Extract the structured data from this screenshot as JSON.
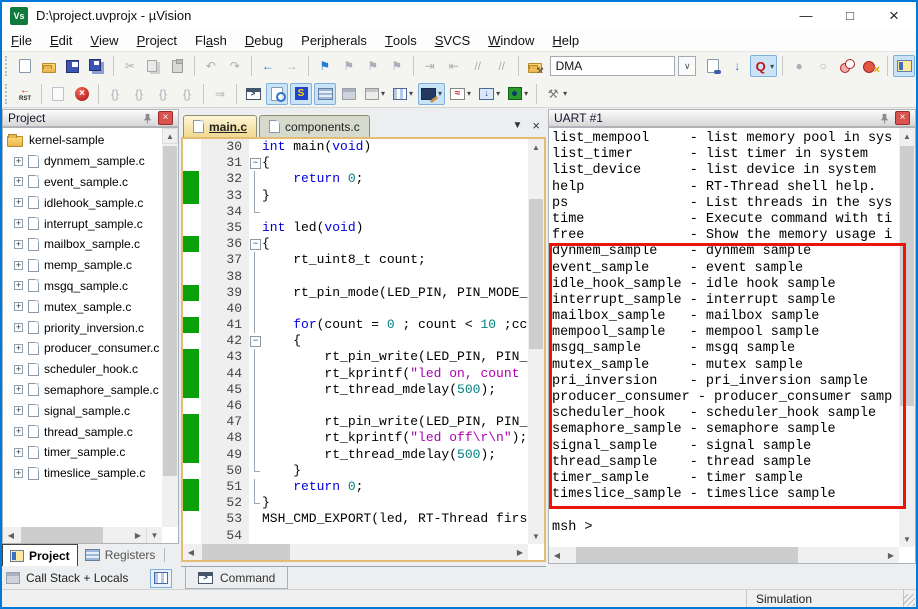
{
  "window": {
    "title": "D:\\project.uvprojx - µVision"
  },
  "colors": {
    "accent": "#0078d7",
    "annotation": "#ea1508",
    "coverage": "#0aa00a",
    "keyword": "#0000e0",
    "number": "#008080",
    "string": "#b000b0"
  },
  "menu": [
    {
      "label": "File",
      "u": 0
    },
    {
      "label": "Edit",
      "u": 0
    },
    {
      "label": "View",
      "u": 0
    },
    {
      "label": "Project",
      "u": 0
    },
    {
      "label": "Flash",
      "u": 2
    },
    {
      "label": "Debug",
      "u": 0
    },
    {
      "label": "Peripherals",
      "u": 3
    },
    {
      "label": "Tools",
      "u": 0
    },
    {
      "label": "SVCS",
      "u": 0
    },
    {
      "label": "Window",
      "u": 0
    },
    {
      "label": "Help",
      "u": 0
    }
  ],
  "toolbar1": [
    {
      "t": "grip"
    },
    {
      "n": "new-file",
      "cl": "i-doc"
    },
    {
      "n": "open-file",
      "cl": "i-folder"
    },
    {
      "n": "save-file",
      "cl": "i-floppy"
    },
    {
      "n": "save-all",
      "cl": "i-floppy2"
    },
    {
      "t": "sep"
    },
    {
      "n": "cut",
      "g": "✂",
      "cl": "g-dis"
    },
    {
      "n": "copy",
      "cl": "i-pages"
    },
    {
      "n": "paste",
      "cl": "i-clip"
    },
    {
      "t": "sep"
    },
    {
      "n": "undo",
      "g": "↶",
      "cl": "g-dis"
    },
    {
      "n": "redo",
      "g": "↷",
      "cl": "g-dis"
    },
    {
      "t": "sep"
    },
    {
      "n": "navigate-back",
      "g": "←",
      "cl": "g-blue"
    },
    {
      "n": "navigate-forward",
      "g": "→",
      "cl": "g-dis"
    },
    {
      "t": "sep"
    },
    {
      "n": "toggle-bookmark",
      "g": "⚑",
      "cl": "g-flag"
    },
    {
      "n": "prev-bookmark",
      "g": "⚑",
      "cl": "g-dis"
    },
    {
      "n": "next-bookmark",
      "g": "⚑",
      "cl": "g-dis"
    },
    {
      "n": "clear-bookmarks",
      "g": "⚑",
      "cl": "g-dis"
    },
    {
      "t": "sep"
    },
    {
      "n": "indent",
      "g": "⇥",
      "cl": "g-dis"
    },
    {
      "n": "outdent",
      "g": "⇤",
      "cl": "g-dis"
    },
    {
      "n": "comment",
      "g": "//",
      "cl": "g-dis"
    },
    {
      "n": "uncomment",
      "g": "//",
      "cl": "g-dis"
    },
    {
      "t": "sep"
    },
    {
      "n": "options-for-target",
      "cl": "i-folder i-fopt"
    },
    {
      "t": "combo",
      "n": "select-target",
      "v": "DMA"
    },
    {
      "t": "ddbtn",
      "n": "select-target-dropdown",
      "g": "∨"
    },
    {
      "n": "find-in-files",
      "cl": "i-doc i-find"
    },
    {
      "n": "find",
      "g": "↓",
      "cl": "g-blue"
    },
    {
      "n": "quick-search",
      "g": "Q",
      "cl": "g-redq",
      "hl": true,
      "dd": true
    },
    {
      "t": "sep"
    },
    {
      "n": "insert-remove-breakpoint",
      "g": "●",
      "cl": "g-dis"
    },
    {
      "n": "enable-disable-breakpoint",
      "g": "○",
      "cl": "g-dis"
    },
    {
      "n": "disable-all-breakpoints",
      "cl": "i-bp2"
    },
    {
      "n": "kill-all-breakpoints",
      "cl": "i-bpx"
    },
    {
      "t": "sep"
    },
    {
      "n": "project-window-toggle",
      "cl": "i-projwin",
      "hl": true
    }
  ],
  "toolbar2": [
    {
      "t": "grip"
    },
    {
      "n": "reset-cpu",
      "g": "RST",
      "cl": "i-rst"
    },
    {
      "t": "sep"
    },
    {
      "n": "show-next-statement",
      "cl": "i-doc i-dis"
    },
    {
      "n": "stop-debug",
      "g": "×",
      "cl": "i-stop"
    },
    {
      "t": "sep"
    },
    {
      "n": "step",
      "g": "{}",
      "cl": "g-dis"
    },
    {
      "n": "step-over",
      "g": "{}",
      "cl": "g-dis"
    },
    {
      "n": "step-out",
      "g": "{}",
      "cl": "g-dis"
    },
    {
      "n": "run-to-cursor",
      "g": "{}",
      "cl": "g-dis"
    },
    {
      "t": "sep"
    },
    {
      "n": "show-current-statement",
      "g": "⇒",
      "cl": "g-dis"
    },
    {
      "t": "sep"
    },
    {
      "n": "command-window",
      "g": ">",
      "cl": "i-term"
    },
    {
      "n": "disassembly-window",
      "cl": "i-doc i-disasm",
      "hl": true
    },
    {
      "n": "symbols-window",
      "g": "S",
      "cl": "i-sym",
      "hl": true
    },
    {
      "n": "registers-window",
      "cl": "i-reg",
      "hl": true
    },
    {
      "n": "callstack-window",
      "cl": "i-stack"
    },
    {
      "n": "watch-window",
      "cl": "i-watch",
      "dd": true
    },
    {
      "n": "memory-window",
      "cl": "i-mem",
      "dd": true
    },
    {
      "n": "serial-window",
      "cl": "i-serial",
      "hl": true,
      "dd": true
    },
    {
      "n": "analysis-window",
      "g": "≈",
      "cl": "i-analysis",
      "dd": true
    },
    {
      "n": "trace-window",
      "g": "↓",
      "cl": "i-trace",
      "dd": true
    },
    {
      "n": "system-viewer",
      "cl": "i-sysview",
      "dd": true
    },
    {
      "t": "sep"
    },
    {
      "n": "debug-tools",
      "g": "⚒",
      "cl": "g-tools",
      "dd": true
    }
  ],
  "project": {
    "title": "Project",
    "root": "kernel-sample",
    "files": [
      "dynmem_sample.c",
      "event_sample.c",
      "idlehook_sample.c",
      "interrupt_sample.c",
      "mailbox_sample.c",
      "memp_sample.c",
      "msgq_sample.c",
      "mutex_sample.c",
      "priority_inversion.c",
      "producer_consumer.c",
      "scheduler_hook.c",
      "semaphore_sample.c",
      "signal_sample.c",
      "thread_sample.c",
      "timer_sample.c",
      "timeslice_sample.c"
    ]
  },
  "editor": {
    "tabs": [
      {
        "label": "main.c"
      },
      {
        "label": "components.c"
      }
    ],
    "lines": [
      {
        "n": 30,
        "cov": false,
        "fold": "",
        "segs": [
          [
            "k",
            "int"
          ],
          [
            "p",
            " main("
          ],
          [
            "k",
            "void"
          ],
          [
            "p",
            ")"
          ]
        ]
      },
      {
        "n": 31,
        "cov": false,
        "fold": "o",
        "segs": [
          [
            "p",
            "{"
          ]
        ]
      },
      {
        "n": 32,
        "cov": true,
        "fold": "l",
        "segs": [
          [
            "p",
            "    "
          ],
          [
            "k",
            "return"
          ],
          [
            "p",
            " "
          ],
          [
            "n",
            "0"
          ],
          [
            "p",
            ";"
          ]
        ]
      },
      {
        "n": 33,
        "cov": true,
        "fold": "l",
        "segs": [
          [
            "p",
            "}"
          ]
        ]
      },
      {
        "n": 34,
        "cov": false,
        "fold": "e",
        "segs": []
      },
      {
        "n": 35,
        "cov": false,
        "fold": "",
        "segs": [
          [
            "k",
            "int"
          ],
          [
            "p",
            " led("
          ],
          [
            "k",
            "void"
          ],
          [
            "p",
            ")"
          ]
        ]
      },
      {
        "n": 36,
        "cov": true,
        "fold": "o",
        "segs": [
          [
            "p",
            "{"
          ]
        ]
      },
      {
        "n": 37,
        "cov": false,
        "fold": "l",
        "segs": [
          [
            "p",
            "    rt_uint8_t count;"
          ]
        ]
      },
      {
        "n": 38,
        "cov": false,
        "fold": "l",
        "segs": []
      },
      {
        "n": 39,
        "cov": true,
        "fold": "l",
        "segs": [
          [
            "p",
            "    rt_pin_mode(LED_PIN, PIN_MODE_"
          ]
        ]
      },
      {
        "n": 40,
        "cov": false,
        "fold": "l",
        "segs": []
      },
      {
        "n": 41,
        "cov": true,
        "fold": "l",
        "segs": [
          [
            "p",
            "    "
          ],
          [
            "k",
            "for"
          ],
          [
            "p",
            "(count = "
          ],
          [
            "n",
            "0"
          ],
          [
            "p",
            " ; count < "
          ],
          [
            "n",
            "10"
          ],
          [
            "p",
            " ;cc"
          ]
        ]
      },
      {
        "n": 42,
        "cov": false,
        "fold": "o",
        "segs": [
          [
            "p",
            "    {"
          ]
        ]
      },
      {
        "n": 43,
        "cov": true,
        "fold": "l",
        "segs": [
          [
            "p",
            "        rt_pin_write(LED_PIN, PIN_"
          ]
        ]
      },
      {
        "n": 44,
        "cov": true,
        "fold": "l",
        "segs": [
          [
            "p",
            "        rt_kprintf("
          ],
          [
            "s",
            "\"led on, count"
          ]
        ]
      },
      {
        "n": 45,
        "cov": true,
        "fold": "l",
        "segs": [
          [
            "p",
            "        rt_thread_mdelay("
          ],
          [
            "n",
            "500"
          ],
          [
            "p",
            ");"
          ]
        ]
      },
      {
        "n": 46,
        "cov": false,
        "fold": "l",
        "segs": []
      },
      {
        "n": 47,
        "cov": true,
        "fold": "l",
        "segs": [
          [
            "p",
            "        rt_pin_write(LED_PIN, PIN_"
          ]
        ]
      },
      {
        "n": 48,
        "cov": true,
        "fold": "l",
        "segs": [
          [
            "p",
            "        rt_kprintf("
          ],
          [
            "s",
            "\"led off\\r\\n\""
          ],
          [
            "p",
            ");"
          ]
        ]
      },
      {
        "n": 49,
        "cov": true,
        "fold": "l",
        "segs": [
          [
            "p",
            "        rt_thread_mdelay("
          ],
          [
            "n",
            "500"
          ],
          [
            "p",
            ");"
          ]
        ]
      },
      {
        "n": 50,
        "cov": false,
        "fold": "e",
        "segs": [
          [
            "p",
            "    }"
          ]
        ]
      },
      {
        "n": 51,
        "cov": true,
        "fold": "l",
        "segs": [
          [
            "p",
            "    "
          ],
          [
            "k",
            "return"
          ],
          [
            "p",
            " "
          ],
          [
            "n",
            "0"
          ],
          [
            "p",
            ";"
          ]
        ]
      },
      {
        "n": 52,
        "cov": true,
        "fold": "e",
        "segs": [
          [
            "p",
            "}"
          ]
        ]
      },
      {
        "n": 53,
        "cov": false,
        "fold": "",
        "segs": [
          [
            "p",
            "MSH_CMD_EXPORT(led, RT-Thread firs"
          ]
        ]
      },
      {
        "n": 54,
        "cov": false,
        "fold": "",
        "segs": []
      }
    ]
  },
  "uart": {
    "title": "UART #1",
    "lines": [
      "list_mempool     - list memory pool in sys",
      "list_timer       - list timer in system",
      "list_device      - list device in system",
      "help             - RT-Thread shell help.",
      "ps               - List threads in the sys",
      "time             - Execute command with ti",
      "free             - Show the memory usage i",
      "dynmem_sample    - dynmem sample",
      "event_sample     - event sample",
      "idle_hook_sample - idle hook sample",
      "interrupt_sample - interrupt sample",
      "mailbox_sample   - mailbox sample",
      "mempool_sample   - mempool sample",
      "msgq_sample      - msgq sample",
      "mutex_sample     - mutex sample",
      "pri_inversion    - pri_inversion sample",
      "producer_consumer - producer_consumer samp",
      "scheduler_hook   - scheduler_hook sample",
      "semaphore_sample - semaphore sample",
      "signal_sample    - signal sample",
      "thread_sample    - thread sample",
      "timer_sample     - timer sample",
      "timeslice_sample - timeslice sample",
      "",
      "msh >"
    ]
  },
  "bottom": {
    "project_tab": "Project",
    "registers_tab": "Registers",
    "callstack_label": "Call Stack + Locals",
    "command_tab": "Command"
  },
  "status": {
    "mode": "Simulation"
  }
}
